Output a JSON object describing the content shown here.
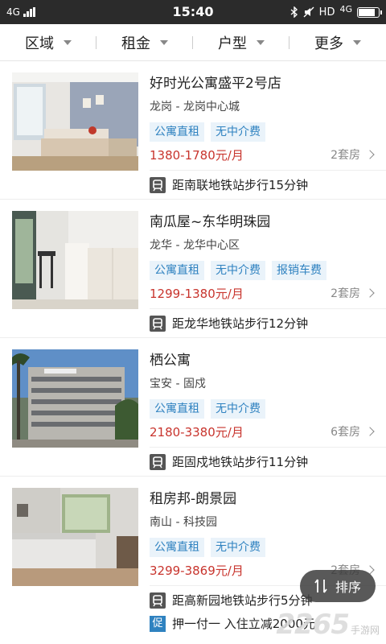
{
  "status_bar": {
    "network": "4G",
    "time": "15:40",
    "hd": "HD",
    "network_right": "4G",
    "battery_level": 0.85
  },
  "filters": [
    {
      "label": "区域"
    },
    {
      "label": "租金"
    },
    {
      "label": "户型"
    },
    {
      "label": "更多"
    }
  ],
  "listings": [
    {
      "title": "好时光公寓盛平2号店",
      "area": "龙岗 - 龙岗中心城",
      "tags": [
        "公寓直租",
        "无中介费"
      ],
      "price": "1380-1780元/月",
      "rooms": "2套房",
      "metro": "距南联地铁站步行15分钟"
    },
    {
      "title": "南瓜屋~东华明珠园",
      "area": "龙华 - 龙华中心区",
      "tags": [
        "公寓直租",
        "无中介费",
        "报销车费"
      ],
      "price": "1299-1380元/月",
      "rooms": "2套房",
      "metro": "距龙华地铁站步行12分钟"
    },
    {
      "title": "栖公寓",
      "area": "宝安 - 固戍",
      "tags": [
        "公寓直租",
        "无中介费"
      ],
      "price": "2180-3380元/月",
      "rooms": "6套房",
      "metro": "距固戍地铁站步行11分钟"
    },
    {
      "title": "租房邦-朗景园",
      "area": "南山 - 科技园",
      "tags": [
        "公寓直租",
        "无中介费"
      ],
      "price": "3299-3869元/月",
      "rooms": "2套房",
      "metro": "距高新园地铁站步行5分钟",
      "promo_icon": "促",
      "promo": "押一付一 入住立减2000元"
    }
  ],
  "sort_button": {
    "label": "排序",
    "icon": "sort-icon"
  },
  "watermark": {
    "number": "2265",
    "text": "手游网"
  },
  "colors": {
    "price": "#c8342d",
    "tag_text": "#2f82c0",
    "tag_bg": "#eaf3fa"
  }
}
